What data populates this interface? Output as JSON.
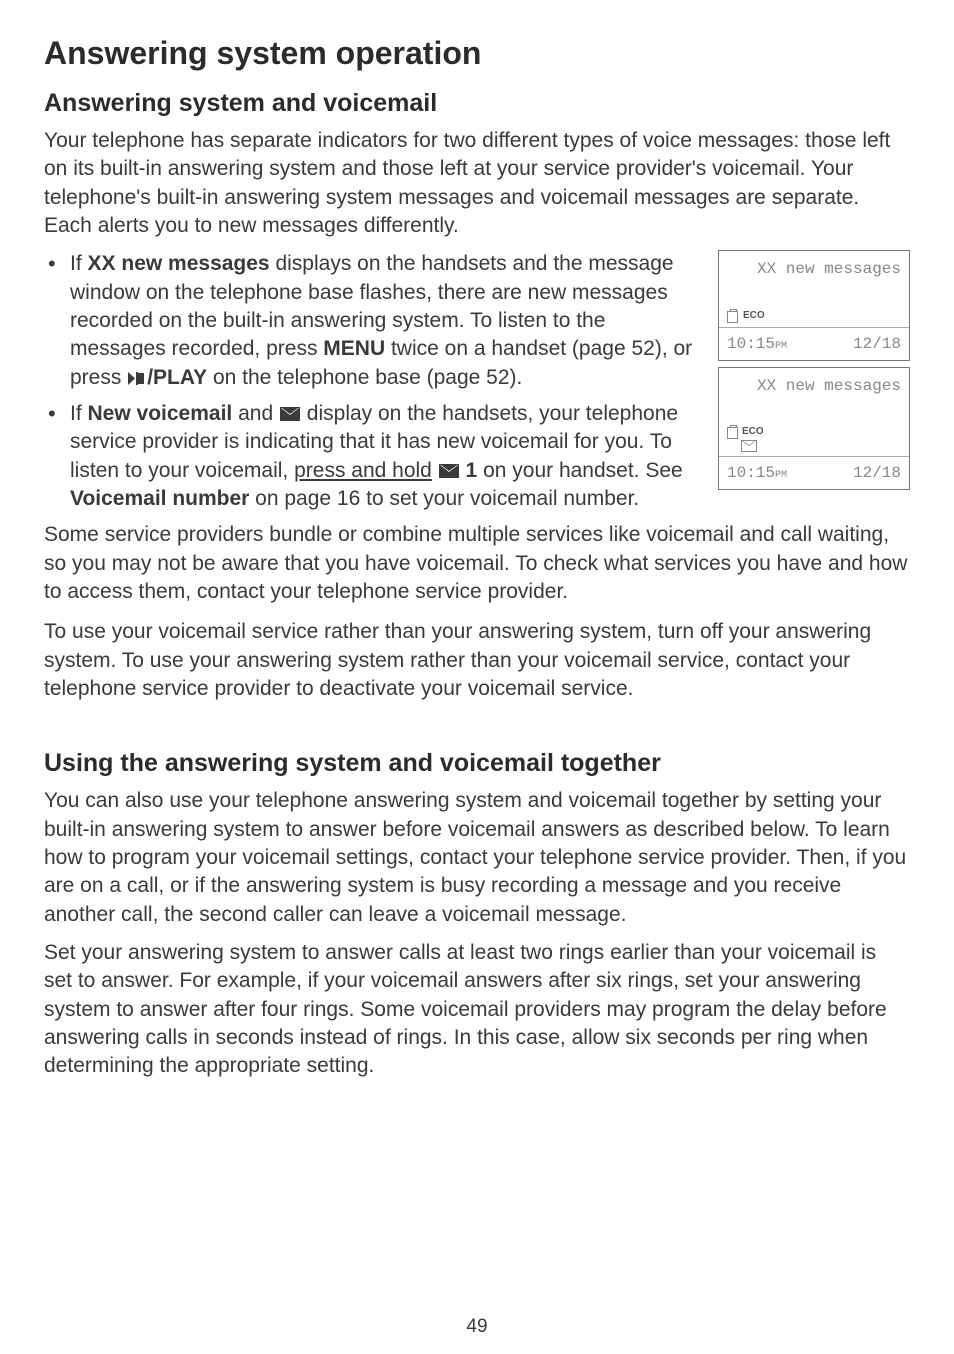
{
  "page": {
    "title": "Answering system operation",
    "subtitle1": "Answering system and voicemail",
    "intro": "Your telephone has separate indicators for two different types of voice messages: those left on its built-in answering system and those left at your service provider's voicemail. Your telephone's built-in answering system messages and voicemail messages are separate. Each alerts you to new messages differently.",
    "bullet1": {
      "t1": "If ",
      "bold1": "XX new messages",
      "t2": " displays on the handsets and the message window on the telephone base flashes, there are new messages recorded on the built-in answering system. To listen to the messages recorded, press ",
      "bold2": "MENU",
      "t3": " twice on a handset (page 52), or press ",
      "bold3": "/PLAY",
      "t4": " on the telephone base (page 52)."
    },
    "bullet2": {
      "t1": "If ",
      "bold1": "New voicemail",
      "t2": " and ",
      "t3": " display on the handsets, your telephone service provider is indicating that it has new voicemail for you. To listen to your voicemail, ",
      "ul1": "press and hold",
      "t4": " ",
      "bold2": "1",
      "t5": " on your handset. See ",
      "bold3": "Voicemail number",
      "t6": " on page 16 to set your voicemail number."
    },
    "para2": "Some service providers bundle or combine multiple services like voicemail and call waiting, so you may not be aware that you have voicemail. To check what services you have and how to access them, contact your telephone service provider.",
    "para3": "To use your voicemail service rather than your answering system, turn off your answering system. To use your answering system rather than your voicemail service, contact your telephone service provider to deactivate your voicemail service.",
    "subtitle2": "Using the answering system and voicemail together",
    "para4": "You can also use your telephone answering system and voicemail together by setting your built-in answering system to answer before voicemail answers as described below. To learn how to program your voicemail settings, contact your telephone service provider. Then, if you are on a call, or if the answering system is busy recording a message and you receive another call, the second caller can leave a voicemail message.",
    "para5": "Set your answering system to answer calls at least two rings earlier than your voicemail is set to answer. For example, if your voicemail answers after six rings, set your answering system to answer after four rings. Some voicemail providers may program the delay before answering calls in seconds instead of rings. In this case, allow six seconds per ring when determining the appropriate setting.",
    "pagenum": "49"
  },
  "screens": [
    {
      "top": "XX new messages",
      "eco": "ECO",
      "mail": false,
      "time": "10:15",
      "ampm": "PM",
      "date": "12/18"
    },
    {
      "top": "XX new messages",
      "eco": "ECO",
      "mail": true,
      "time": "10:15",
      "ampm": "PM",
      "date": "12/18"
    }
  ]
}
